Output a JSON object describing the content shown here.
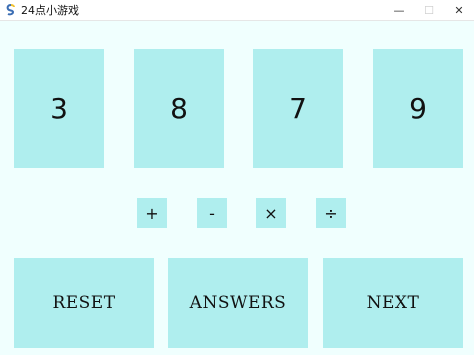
{
  "window": {
    "title": "24点小游戏",
    "minimize_glyph": "—",
    "maximize_glyph": "☐",
    "close_glyph": "✕"
  },
  "cards": [
    "3",
    "8",
    "7",
    "9"
  ],
  "operators": [
    "+",
    "-",
    "×",
    "÷"
  ],
  "actions": {
    "reset_label": "RESET",
    "answers_label": "ANSWERS",
    "next_label": "NEXT"
  },
  "colors": {
    "background": "#f0fffe",
    "tile": "#afeeee"
  },
  "icons": {
    "app": "pygame-snake-icon"
  }
}
